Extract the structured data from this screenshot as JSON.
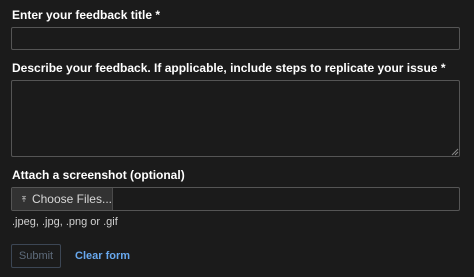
{
  "form": {
    "title_label": "Enter your feedback title *",
    "title_value": "",
    "description_label": "Describe your feedback. If applicable, include steps to replicate your issue *",
    "description_value": "",
    "screenshot_label": "Attach a screenshot (optional)",
    "choose_files_label": "Choose Files...",
    "upload_icon": "upload-icon",
    "file_types_hint": ".jpeg, .jpg, .png or .gif",
    "submit_label": "Submit",
    "submit_state": "disabled",
    "clear_label": "Clear form"
  },
  "colors": {
    "background": "#1b1b1b",
    "field_border": "#555555",
    "link": "#68a8ee",
    "disabled_text": "#5e6b7b"
  }
}
